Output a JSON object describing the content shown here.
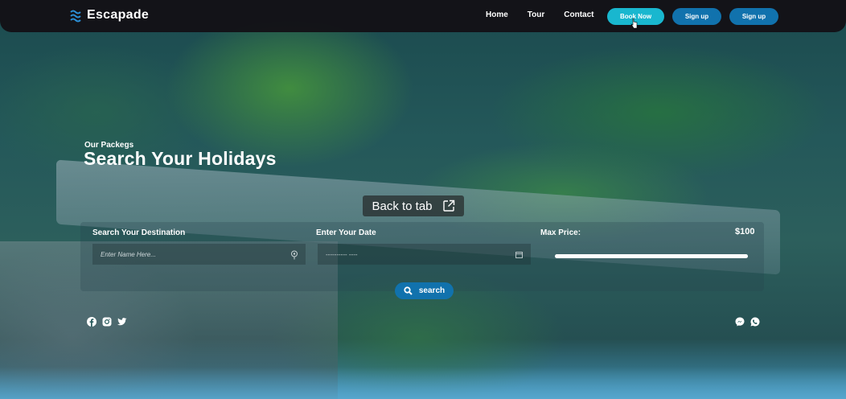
{
  "brand": {
    "name": "Escapade",
    "icon": "waves-icon"
  },
  "nav": {
    "links": [
      "Home",
      "Tour",
      "Contact"
    ],
    "book_now": "Book Now",
    "sign_up_1": "Sign up",
    "sign_up_2": "Sign up"
  },
  "hero": {
    "subtitle": "Our Packegs",
    "title": "Search Your Holidays"
  },
  "overlay": {
    "back_to_tab": "Back to tab",
    "icon": "external-link-icon"
  },
  "search": {
    "destination_label": "Search Your Destination",
    "destination_placeholder": "Enter Name Here...",
    "date_label": "Enter Your Date",
    "date_placeholder": "---------- ----",
    "price_label": "Max Price:",
    "price_value": "$100",
    "price_fill_fraction": 1.0,
    "button_label": "search"
  },
  "social_left": [
    "facebook-icon",
    "instagram-icon",
    "twitter-icon"
  ],
  "social_right": [
    "messenger-icon",
    "whatsapp-icon"
  ],
  "colors": {
    "book_now": "#19b7cf",
    "primary_button": "#1172ad",
    "nav_bg": "#120e14"
  }
}
